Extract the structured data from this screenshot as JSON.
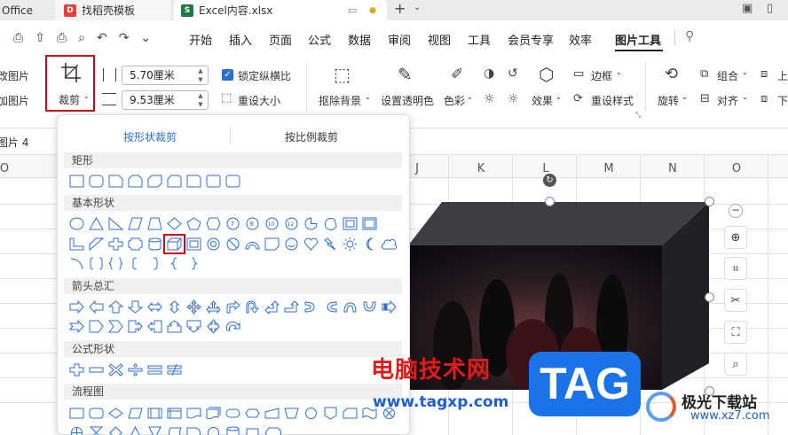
{
  "tabs": [
    {
      "label": "Office"
    },
    {
      "label": "找稻壳模板"
    },
    {
      "label": "Excel内容.xlsx"
    }
  ],
  "menu": [
    "开始",
    "插入",
    "页面",
    "公式",
    "数据",
    "审阅",
    "视图",
    "工具",
    "会员专享",
    "效率",
    "图片工具"
  ],
  "ribbon": {
    "add_picture": "改图片",
    "add_picture2": "加图片",
    "crop_label": "裁剪",
    "width_value": "5.70厘米",
    "height_value": "9.53厘米",
    "lock_ratio": "锁定纵横比",
    "reset_size": "重设大小",
    "remove_bg": "抠除背景",
    "set_transparent": "设置透明色",
    "color": "色彩",
    "effect": "效果",
    "border": "边框",
    "reset_style": "重设样式",
    "rotate": "旋转",
    "group": "组合",
    "align": "对齐",
    "up": "上",
    "down": "下"
  },
  "namebox": "图片 4",
  "columns": [
    "O",
    "J",
    "K",
    "L",
    "M",
    "N",
    "O"
  ],
  "crop_panel": {
    "tab_shape": "按形状裁剪",
    "tab_ratio": "按比例裁剪",
    "sections": [
      "矩形",
      "基本形状",
      "箭头总汇",
      "公式形状",
      "流程图"
    ]
  },
  "watermark": {
    "title": "电脑技术网",
    "url": "www.tagxp.com",
    "tag": "TAG",
    "site": "极光下载站",
    "site_url": "www.xz7.com"
  },
  "colors": {
    "accent": "#2b6fd6",
    "highlight": "#d0021b",
    "excel_green": "#1d7a45"
  }
}
